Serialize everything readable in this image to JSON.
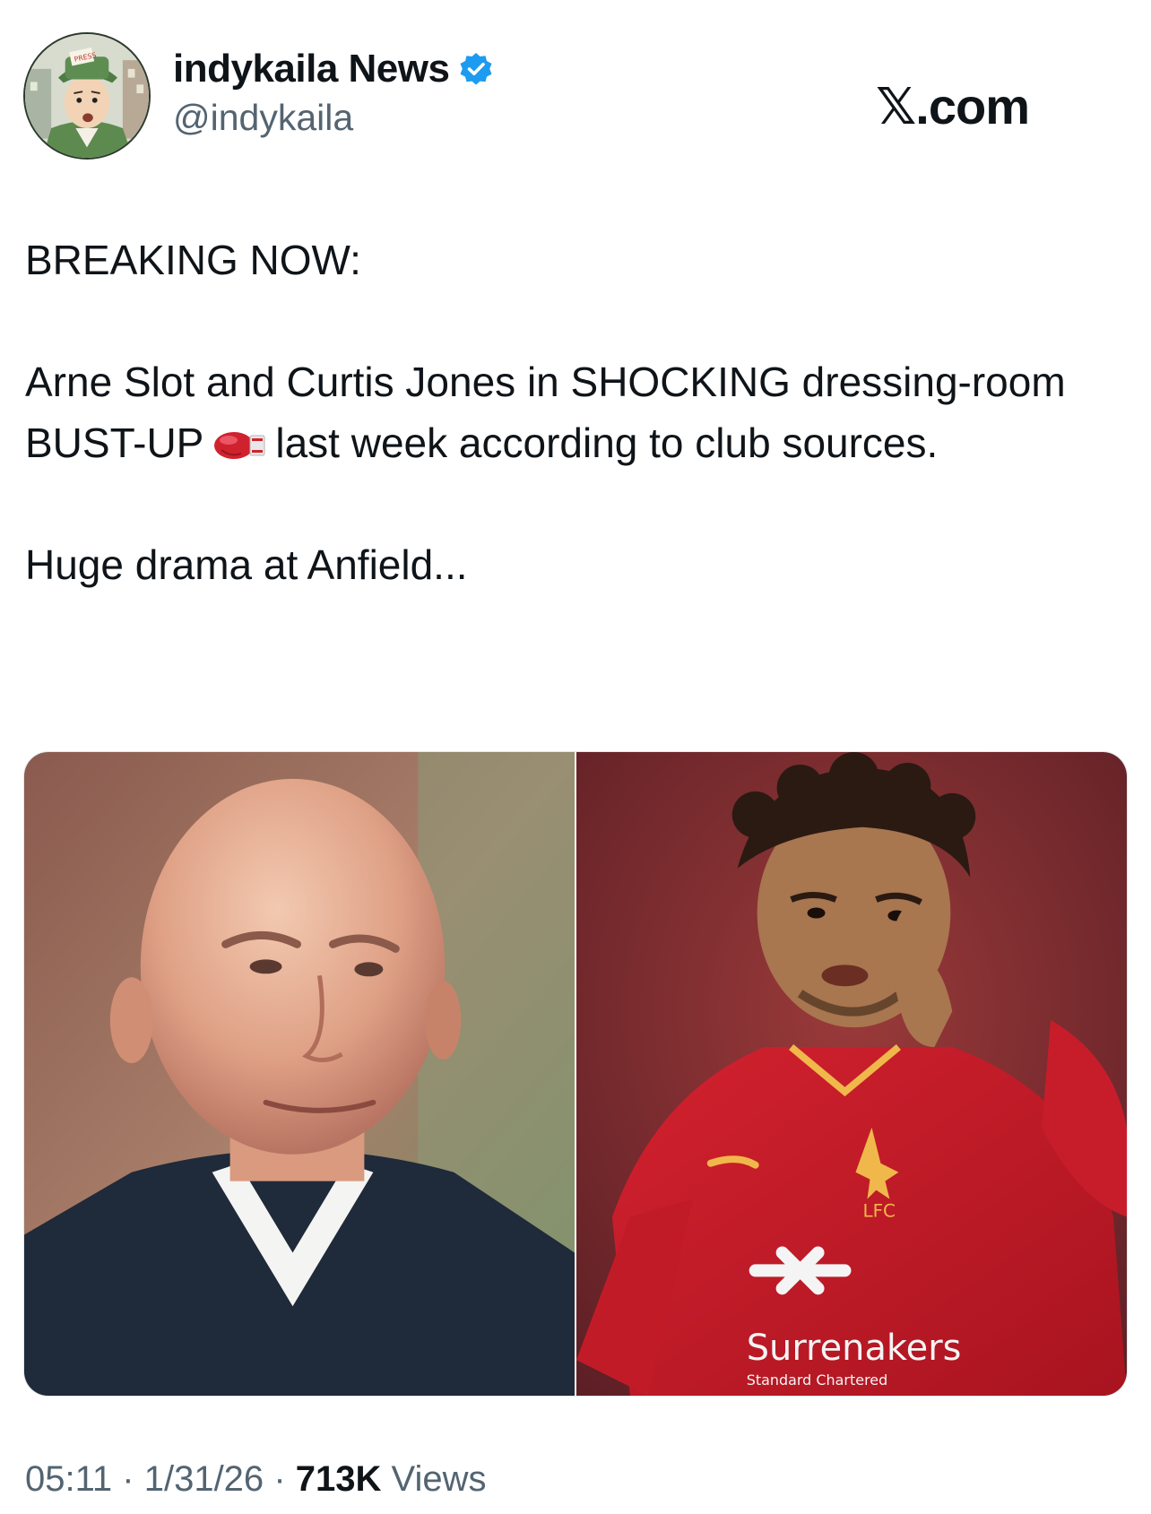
{
  "account": {
    "display_name": "indykaila News",
    "handle": "@indykaila",
    "verified_icon": "verified-badge-icon",
    "avatar_icon": "cartoon-reporter-avatar",
    "badge_color": "#1d9bf0"
  },
  "site": "𝕏.com",
  "tweet": {
    "line1": "BREAKING NOW:",
    "line2_before": "Arne Slot and Curtis Jones in SHOCKING dressing-room BUST-UP",
    "line2_emoji": "boxing-glove-icon",
    "line2_after": "last week according to club sources.",
    "line3": "Huge drama at Anfield..."
  },
  "media": {
    "left_image": "photo-arne-slot",
    "right_image": "photo-curtis-jones",
    "shirt_sponsor": "Surrenakers",
    "shirt_sponsor_sub": "Standard Chartered",
    "shirt_badge": "LFC"
  },
  "meta": {
    "time": "05:11",
    "separator": "·",
    "date": "1/31/26",
    "views_count": "713K",
    "views_label": "Views"
  }
}
